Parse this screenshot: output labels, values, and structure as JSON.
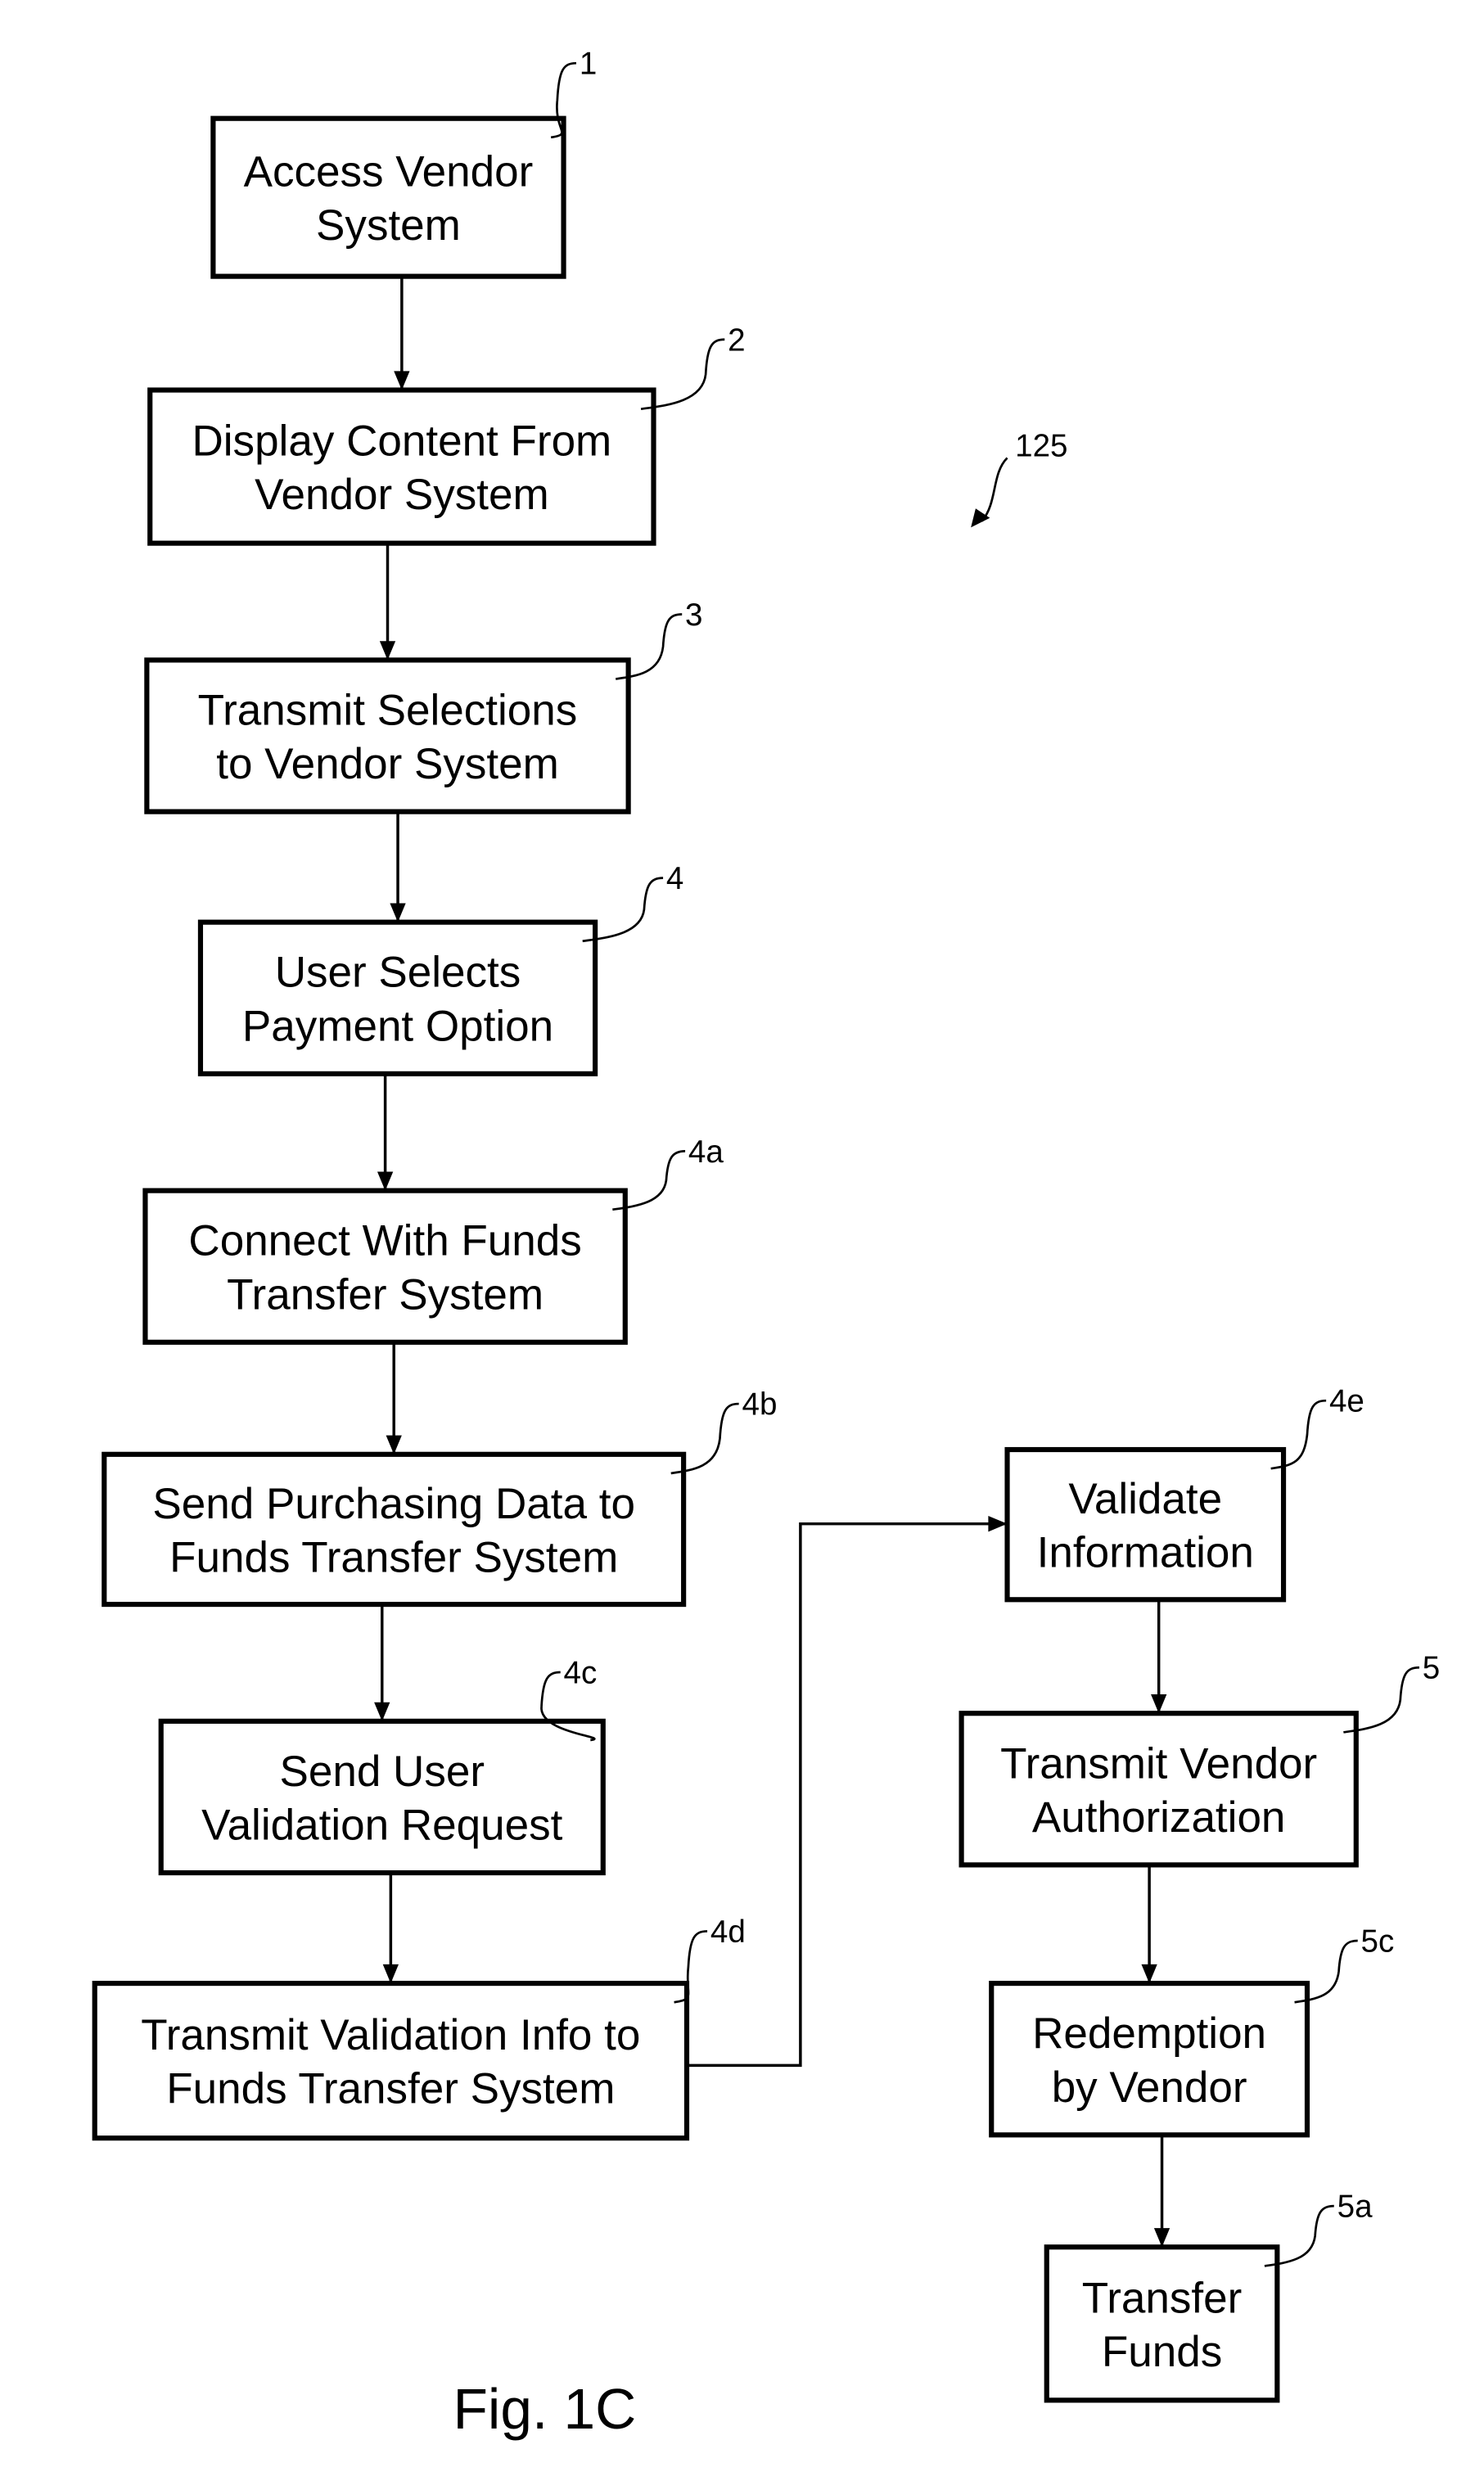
{
  "figure": {
    "caption": "Fig. 1C",
    "reference_number": "125"
  },
  "steps": [
    {
      "id": "1",
      "ref": "1",
      "lines": [
        "Access Vendor",
        "System"
      ]
    },
    {
      "id": "2",
      "ref": "2",
      "lines": [
        "Display Content From",
        "Vendor System"
      ]
    },
    {
      "id": "3",
      "ref": "3",
      "lines": [
        "Transmit Selections",
        "to Vendor System"
      ]
    },
    {
      "id": "4",
      "ref": "4",
      "lines": [
        "User Selects",
        "Payment Option"
      ]
    },
    {
      "id": "4a",
      "ref": "4a",
      "lines": [
        "Connect With Funds",
        "Transfer System"
      ]
    },
    {
      "id": "4b",
      "ref": "4b",
      "lines": [
        "Send Purchasing Data to",
        "Funds Transfer System"
      ]
    },
    {
      "id": "4c",
      "ref": "4c",
      "lines": [
        "Send User",
        "Validation Request"
      ]
    },
    {
      "id": "4d",
      "ref": "4d",
      "lines": [
        "Transmit Validation Info to",
        "Funds Transfer System"
      ]
    },
    {
      "id": "4e",
      "ref": "4e",
      "lines": [
        "Validate",
        "Information"
      ]
    },
    {
      "id": "5",
      "ref": "5",
      "lines": [
        "Transmit Vendor",
        "Authorization"
      ]
    },
    {
      "id": "5c",
      "ref": "5c",
      "lines": [
        "Redemption",
        "by Vendor"
      ]
    },
    {
      "id": "5a",
      "ref": "5a",
      "lines": [
        "Transfer",
        "Funds"
      ]
    }
  ],
  "flow": [
    [
      "1",
      "2"
    ],
    [
      "2",
      "3"
    ],
    [
      "3",
      "4"
    ],
    [
      "4",
      "4a"
    ],
    [
      "4a",
      "4b"
    ],
    [
      "4b",
      "4c"
    ],
    [
      "4c",
      "4d"
    ],
    [
      "4d",
      "4e"
    ],
    [
      "4e",
      "5"
    ],
    [
      "5",
      "5c"
    ],
    [
      "5c",
      "5a"
    ]
  ]
}
